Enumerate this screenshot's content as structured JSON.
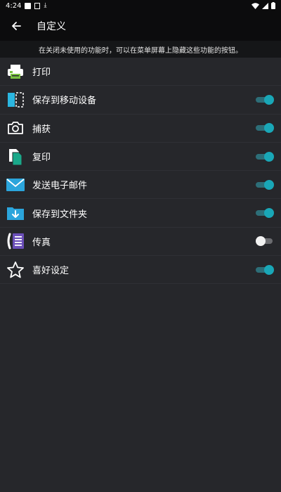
{
  "status_bar": {
    "time": "4:24"
  },
  "app_bar": {
    "title": "自定义"
  },
  "notice": "在关闭未使用的功能时，可以在菜单屏幕上隐藏这些功能的按钮。",
  "items": [
    {
      "label": "打印",
      "icon": "printer-icon"
    },
    {
      "label": "保存到移动设备",
      "icon": "save-to-device-icon",
      "enabled": true
    },
    {
      "label": "捕获",
      "icon": "camera-icon",
      "enabled": true
    },
    {
      "label": "复印",
      "icon": "copy-icon",
      "enabled": true
    },
    {
      "label": "发送电子邮件",
      "icon": "email-icon",
      "enabled": true
    },
    {
      "label": "保存到文件夹",
      "icon": "folder-download-icon",
      "enabled": true
    },
    {
      "label": "传真",
      "icon": "fax-icon",
      "enabled": false
    },
    {
      "label": "喜好设定",
      "icon": "star-icon",
      "enabled": true
    }
  ],
  "colors": {
    "accent": "#19a7b7",
    "background": "#26272b",
    "bar": "#0c0c0d"
  }
}
